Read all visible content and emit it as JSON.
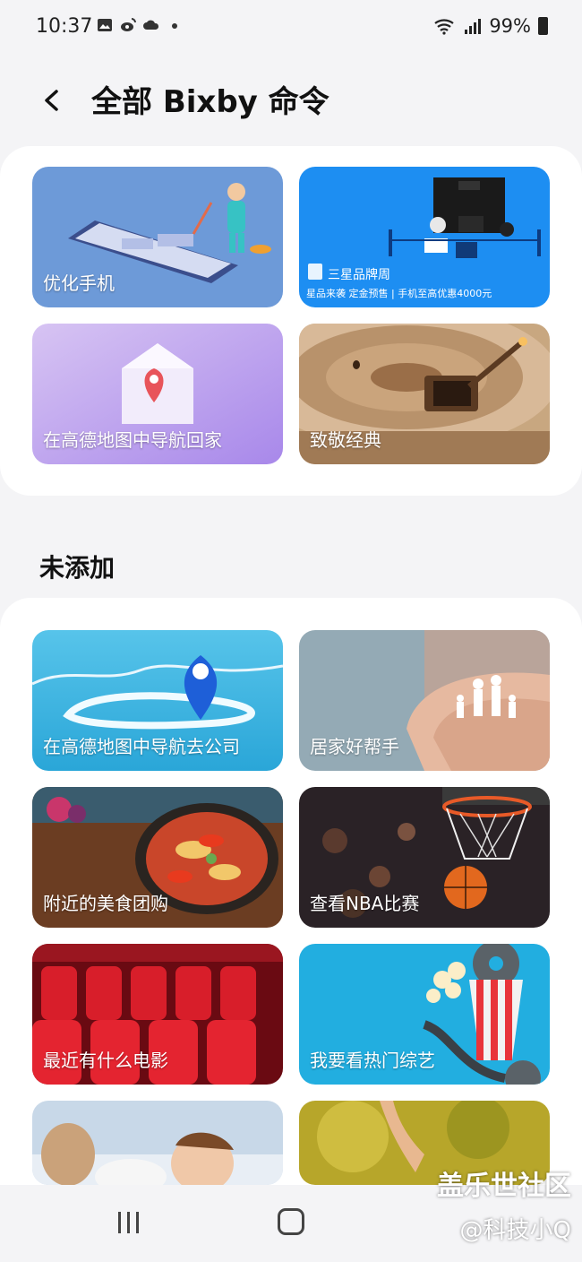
{
  "status": {
    "time": "10:37",
    "battery": "99%"
  },
  "header": {
    "title": "全部 Bixby 命令"
  },
  "added_cards": [
    {
      "label": "优化手机"
    },
    {
      "label": "",
      "banner_title": "三星品牌周",
      "banner_sub": "星品来袭 定金预售 | 手机至高优惠4000元"
    },
    {
      "label": "在高德地图中导航回家"
    },
    {
      "label": "致敬经典"
    }
  ],
  "section": {
    "not_added": "未添加"
  },
  "not_added_cards": [
    {
      "label": "在高德地图中导航去公司"
    },
    {
      "label": "居家好帮手"
    },
    {
      "label": "附近的美食团购"
    },
    {
      "label": "查看NBA比赛"
    },
    {
      "label": "最近有什么电影"
    },
    {
      "label": "我要看热门综艺"
    },
    {
      "label": ""
    },
    {
      "label": ""
    }
  ],
  "watermark": {
    "line1": "盖乐世社区",
    "line2": "@科技小Q"
  }
}
